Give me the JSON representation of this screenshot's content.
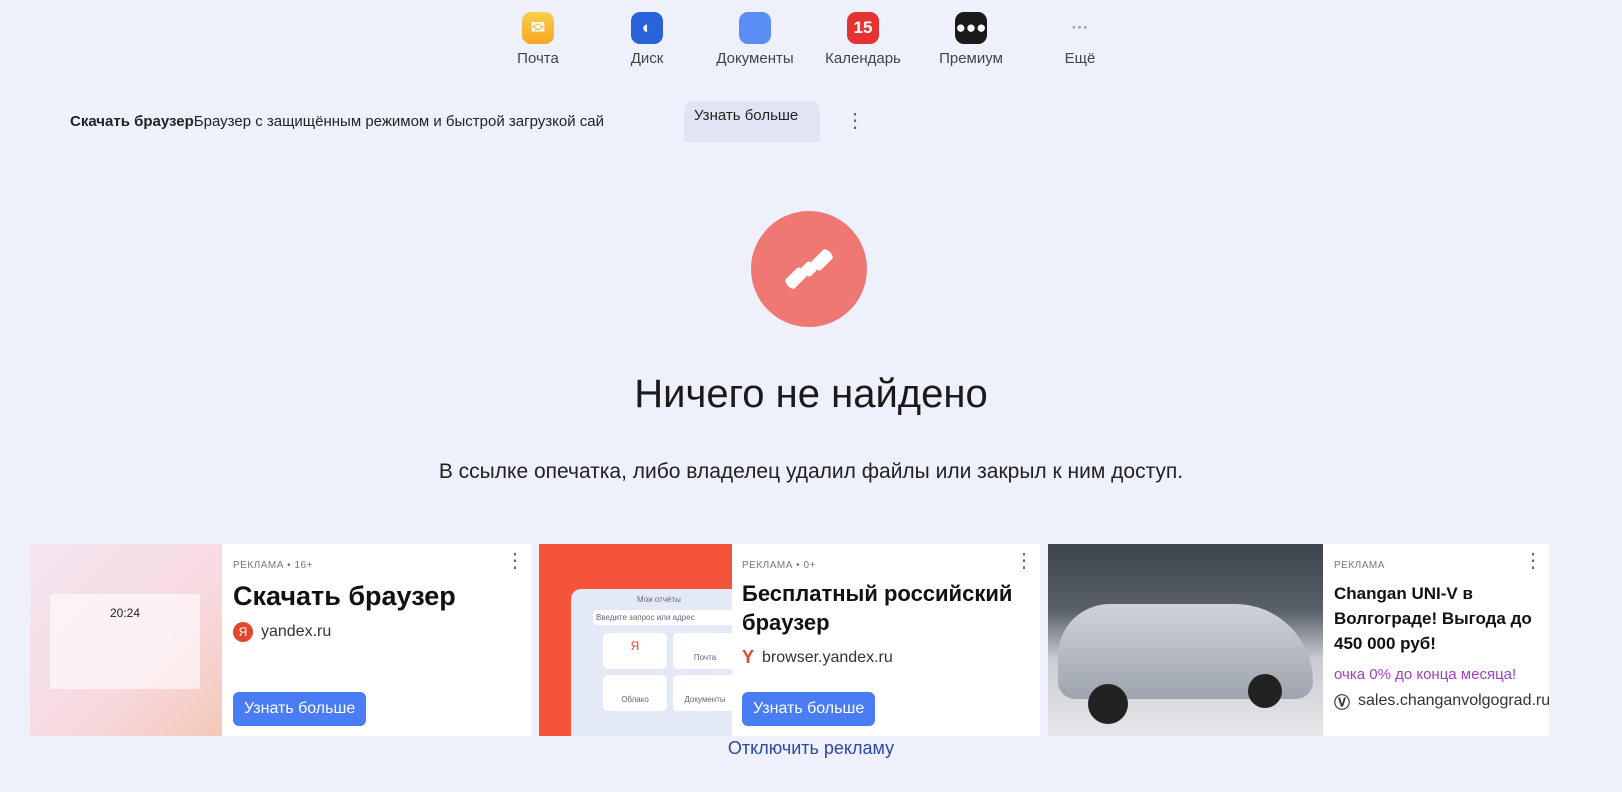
{
  "services": [
    {
      "label": "Почта",
      "icon": "mail-icon",
      "color": "#f6b925"
    },
    {
      "label": "Диск",
      "icon": "disk-icon",
      "color": "#2a62d9"
    },
    {
      "label": "Документы",
      "icon": "documents-icon",
      "color": "#5b8ef5"
    },
    {
      "label": "Календарь",
      "icon": "calendar-icon",
      "color": "#e33333",
      "badge": "15"
    },
    {
      "label": "Премиум",
      "icon": "premium-icon",
      "color": "#1a1a1a"
    },
    {
      "label": "Ещё",
      "icon": "more-icon",
      "color": "#9aa0ae"
    }
  ],
  "promo": {
    "title": "Скачать браузер",
    "text": "Браузер с защищённым режимом и быстрой загрузкой сай",
    "button": "Узнать больше"
  },
  "error": {
    "title": "Ничего не найдено",
    "message": "В ссылке опечатка, либо владелец удалил файлы или закрыл к ним доступ."
  },
  "ads": [
    {
      "label": "РЕКЛАМА • 16+",
      "title": "Скачать браузер",
      "domain": "yandex.ru",
      "button": "Узнать больше",
      "preview_time": "20:24"
    },
    {
      "label": "РЕКЛАМА • 0+",
      "title": "Бесплатный российский браузер",
      "domain": "browser.yandex.ru",
      "button": "Узнать больше",
      "preview": {
        "tab": "Мои отчёты",
        "search": "Введите запрос или адрес",
        "tiles": [
          "Я",
          "Почта",
          "Облако",
          "Документы"
        ]
      }
    },
    {
      "label": "РЕКЛАМА",
      "title": "Changan UNI-V в Волгограде! Выгода до 450 000 руб!",
      "promo": "очка 0% до конца месяца!",
      "domain": "sales.changanvolgograd.ru"
    }
  ],
  "disable_ads": "Отключить рекламу",
  "accent": "#4a7cf5"
}
